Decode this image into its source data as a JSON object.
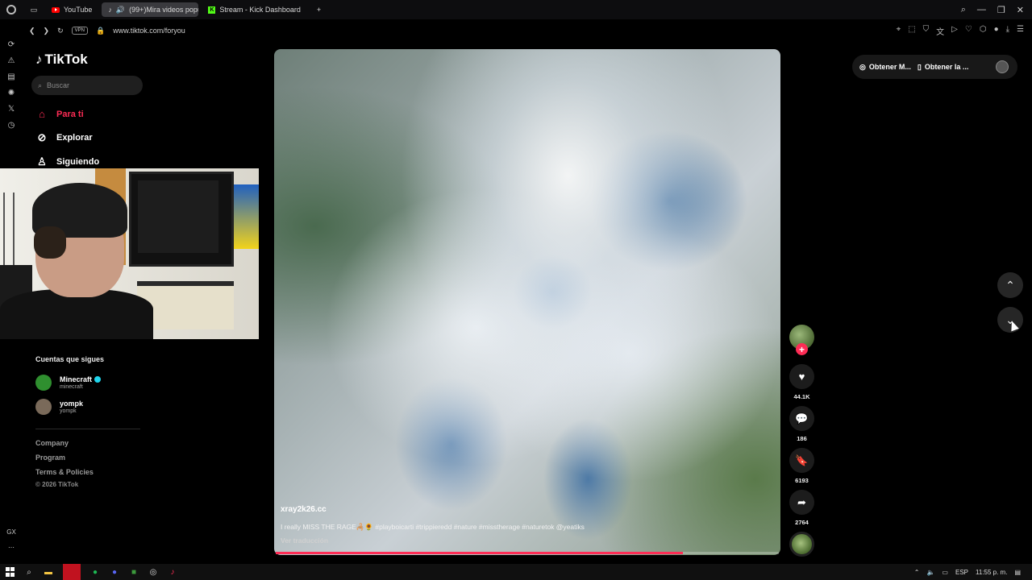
{
  "browser": {
    "tabs": [
      {
        "label": "YouTube",
        "icon": "youtube-icon"
      },
      {
        "label": "(99+)Mira videos popu",
        "icon": "tiktok-icon",
        "active": true
      },
      {
        "label": "Stream - Kick Dashboard",
        "icon": "kick-icon"
      }
    ],
    "new_tab": "+",
    "vpn": "VPN",
    "url": "www.tiktok.com/foryou"
  },
  "opera_sidebar": {
    "x_label": "𝕏",
    "gx_label": "GX",
    "more": "⋯"
  },
  "tiktok": {
    "logo": "TikTok",
    "search_placeholder": "Buscar",
    "nav": [
      {
        "label": "Para ti",
        "icon": "home-icon",
        "active": true
      },
      {
        "label": "Explorar",
        "icon": "compass-icon"
      },
      {
        "label": "Siguiendo",
        "icon": "following-icon"
      }
    ],
    "following_title": "Cuentas que sigues",
    "following": [
      {
        "name": "Minecraft",
        "handle": "minecraft",
        "verified": true
      },
      {
        "name": "yompk",
        "handle": "yompk",
        "verified": false
      }
    ],
    "footer": [
      "Company",
      "Program",
      "Terms & Policies"
    ],
    "copyright": "© 2026 TikTok",
    "top_right": {
      "coins": "Obtener M...",
      "app": "Obtener la ..."
    }
  },
  "video": {
    "username": "xray2k26.cc",
    "caption": "I really MISS THE RAGE🦂🌻 #playboicarti #trippieredd #nature #misstherage #naturetok @yeatiks",
    "translate": "Ver traducción",
    "progress_percent": 81,
    "likes": "44.1K",
    "comments": "186",
    "saves": "6193",
    "shares": "2764",
    "follow_plus": "+"
  },
  "taskbar": {
    "lang": "ESP",
    "time": "11:55 p. m."
  },
  "colors": {
    "accent": "#fe2c55",
    "verified": "#20d5ec"
  }
}
